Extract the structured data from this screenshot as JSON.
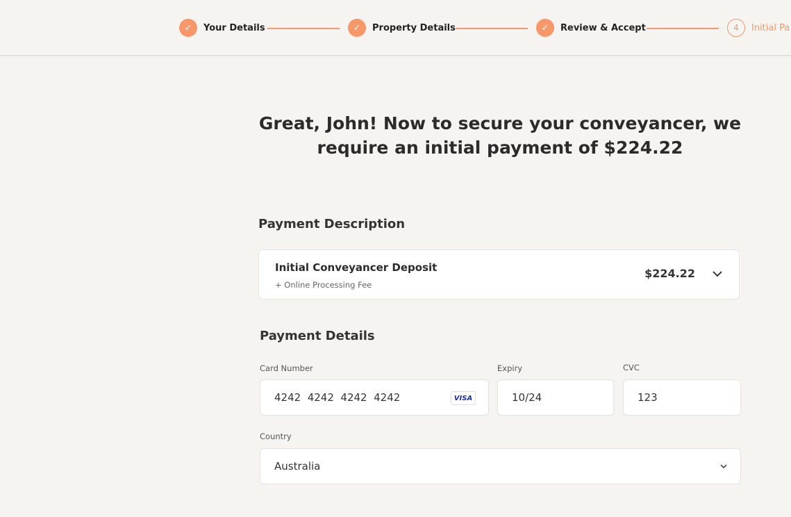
{
  "stepper": {
    "steps": [
      {
        "label": "Your Details",
        "status": "complete"
      },
      {
        "label": "Property Details",
        "status": "complete"
      },
      {
        "label": "Review & Accept",
        "status": "complete"
      },
      {
        "label": "Initial Payment",
        "number": "4",
        "status": "current",
        "visible_label": "Initial Pa"
      }
    ],
    "accent": "#f7976a"
  },
  "headline": "Great, John! Now to secure your conveyancer, we require an initial payment of $224.22",
  "payment_description": {
    "title": "Payment Description",
    "item_name": "Initial Conveyancer Deposit",
    "item_sub": "+ Online Processing Fee",
    "amount": "$224.22"
  },
  "payment_details": {
    "title": "Payment Details",
    "card_label": "Card Number",
    "card_value": "4242  4242  4242  4242",
    "card_brand": "VISA",
    "expiry_label": "Expiry",
    "expiry_value": "10/24",
    "cvc_label": "CVC",
    "cvc_value": "123",
    "country_label": "Country",
    "country_value": "Australia"
  }
}
